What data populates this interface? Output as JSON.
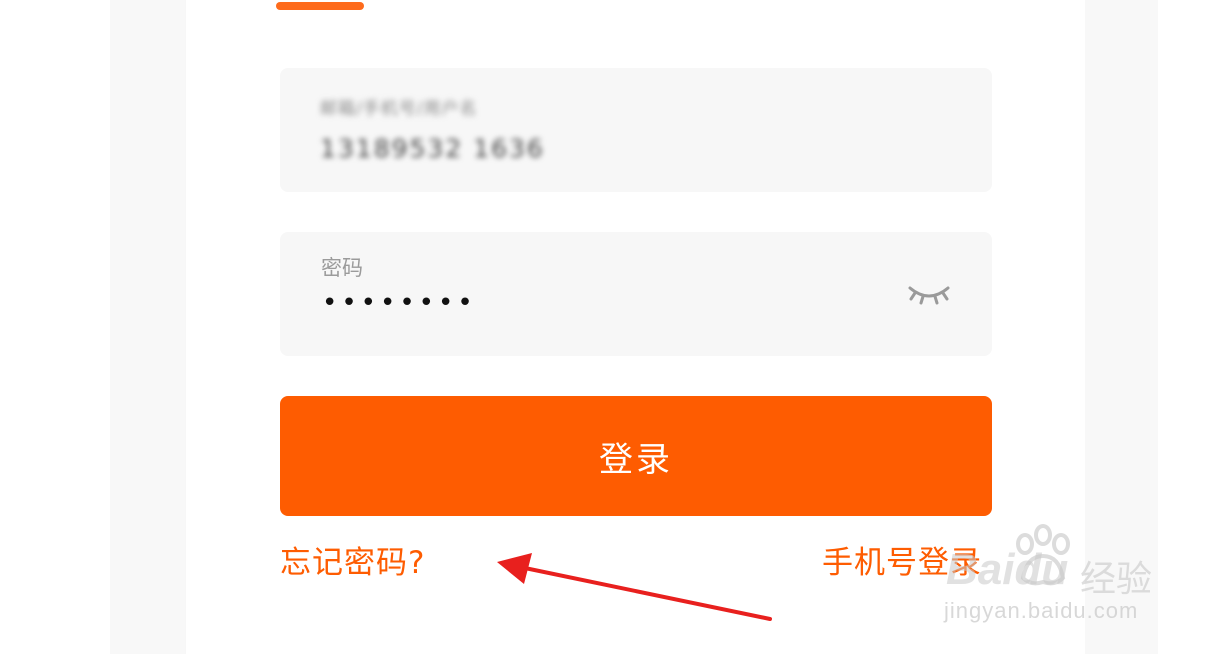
{
  "login_form": {
    "account_field": {
      "label": "邮箱/手机号/用户名",
      "value": "13189532 1636"
    },
    "password_field": {
      "label": "密码",
      "value": "••••••••",
      "visibility_icon": "eye-closed-icon"
    },
    "login_button": {
      "label": "登录"
    },
    "forgot_password_link": {
      "label": "忘记密码?"
    },
    "phone_login_link": {
      "label": "手机号登录"
    }
  },
  "watermark": {
    "brand": "Baidu",
    "brand_cn": "经验",
    "url": "jingyan.baidu.com"
  },
  "colors": {
    "accent": "#fe5c01",
    "field_bg": "#f7f7f7",
    "arrow": "#e8201e"
  }
}
